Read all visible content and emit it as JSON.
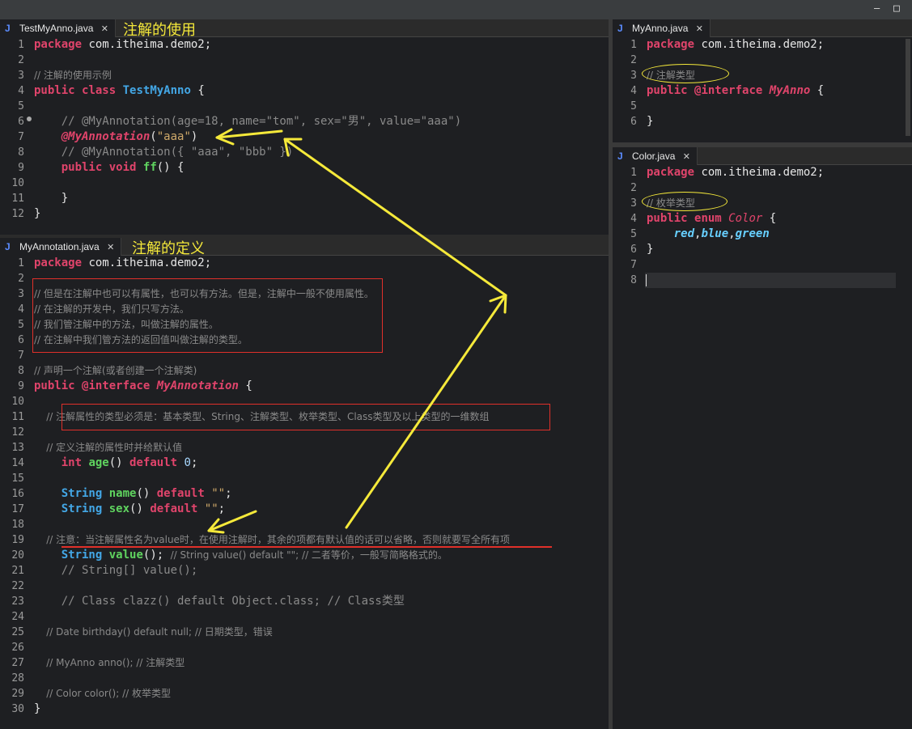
{
  "window": {
    "minimize_label": "—",
    "maximize_label": "□"
  },
  "panes": {
    "testmyanno": {
      "tab": "TestMyAnno.java",
      "annotation": "注解的使用",
      "lines": [
        {
          "n": "1"
        },
        {
          "n": "2"
        },
        {
          "n": "3"
        },
        {
          "n": "4"
        },
        {
          "n": "5"
        },
        {
          "n": "6"
        },
        {
          "n": "7"
        },
        {
          "n": "8"
        },
        {
          "n": "9"
        },
        {
          "n": "10"
        },
        {
          "n": "11"
        },
        {
          "n": "12"
        }
      ],
      "code": {
        "l1a": "package",
        "l1b": " com.itheima.demo2;",
        "l3": "// 注解的使用示例",
        "l4a": "public",
        "l4b": " ",
        "l4c": "class",
        "l4d": " ",
        "l4e": "TestMyAnno",
        "l4f": " {",
        "l6": "    // @MyAnnotation(age=18, name=\"tom\", sex=\"男\", value=\"aaa\")",
        "l7a": "    ",
        "l7b": "@MyAnnotation",
        "l7c": "(",
        "l7d": "\"aaa\"",
        "l7e": ")",
        "l8": "    // @MyAnnotation({ \"aaa\", \"bbb\" })",
        "l9a": "    ",
        "l9b": "public",
        "l9c": " ",
        "l9d": "void",
        "l9e": " ",
        "l9f": "ff",
        "l9g": "() {",
        "l11": "    }",
        "l12": "}"
      }
    },
    "myannotation": {
      "tab": "MyAnnotation.java",
      "annotation": "注解的定义",
      "code": {
        "l1a": "package",
        "l1b": " com.itheima.demo2;",
        "l3": "// 但是在注解中也可以有属性，也可以有方法。但是，注解中一般不使用属性。",
        "l4": "// 在注解的开发中，我们只写方法。",
        "l5": "// 我们管注解中的方法，叫做注解的属性。",
        "l6": "// 在注解中我们管方法的返回值叫做注解的类型。",
        "l8": "// 声明一个注解(或者创建一个注解类)",
        "l9a": "public",
        "l9b": " ",
        "l9c": "@interface",
        "l9d": " ",
        "l9e": "MyAnnotation",
        "l9f": " {",
        "l11": "    // 注解属性的类型必须是：基本类型、String、注解类型、枚举类型、Class类型及以上类型的一维数组",
        "l13": "    // 定义注解的属性时并给默认值",
        "l14a": "    ",
        "l14b": "int",
        "l14c": " ",
        "l14d": "age",
        "l14e": "() ",
        "l14f": "default",
        "l14g": " ",
        "l14h": "0",
        "l14i": ";",
        "l16a": "    ",
        "l16b": "String",
        "l16c": " ",
        "l16d": "name",
        "l16e": "() ",
        "l16f": "default",
        "l16g": " ",
        "l16h": "\"\"",
        "l16i": ";",
        "l17a": "    ",
        "l17b": "String",
        "l17c": " ",
        "l17d": "sex",
        "l17e": "() ",
        "l17f": "default",
        "l17g": " ",
        "l17h": "\"\"",
        "l17i": ";",
        "l19": "    // 注意：当注解属性名为value时，在使用注解时，其余的项都有默认值的话可以省略，否则就要写全所有项",
        "l20a": "    ",
        "l20b": "String",
        "l20c": " ",
        "l20d": "value",
        "l20e": "(); ",
        "l20f": "// String value() default \"\"; // 二者等价，一般写简略格式的。",
        "l21": "    // String[] value();",
        "l23": "    // Class clazz() default Object.class; // Class类型",
        "l25": "    // Date birthday() default null; // 日期类型，错误",
        "l27": "    // MyAnno anno(); // 注解类型",
        "l29": "    // Color color(); // 枚举类型",
        "l30": "}"
      }
    },
    "myanno": {
      "tab": "MyAnno.java",
      "code": {
        "l1a": "package",
        "l1b": " com.itheima.demo2;",
        "l3": "// 注解类型",
        "l4a": "public",
        "l4b": " ",
        "l4c": "@interface",
        "l4d": " ",
        "l4e": "MyAnno",
        "l4f": " {",
        "l6": "}"
      }
    },
    "color": {
      "tab": "Color.java",
      "code": {
        "l1a": "package",
        "l1b": " com.itheima.demo2;",
        "l3": "// 枚举类型",
        "l4a": "public",
        "l4b": " ",
        "l4c": "enum",
        "l4d": " ",
        "l4e": "Color",
        "l4f": " {",
        "l5a": "    ",
        "l5b": "red",
        "l5c": ",",
        "l5d": "blue",
        "l5e": ",",
        "l5f": "green",
        "l6": "}"
      }
    }
  },
  "colors": {
    "annotation_yellow": "#f5e93a",
    "box_red": "#e0302a",
    "keyword": "#e0446b",
    "type": "#43a7e6"
  }
}
